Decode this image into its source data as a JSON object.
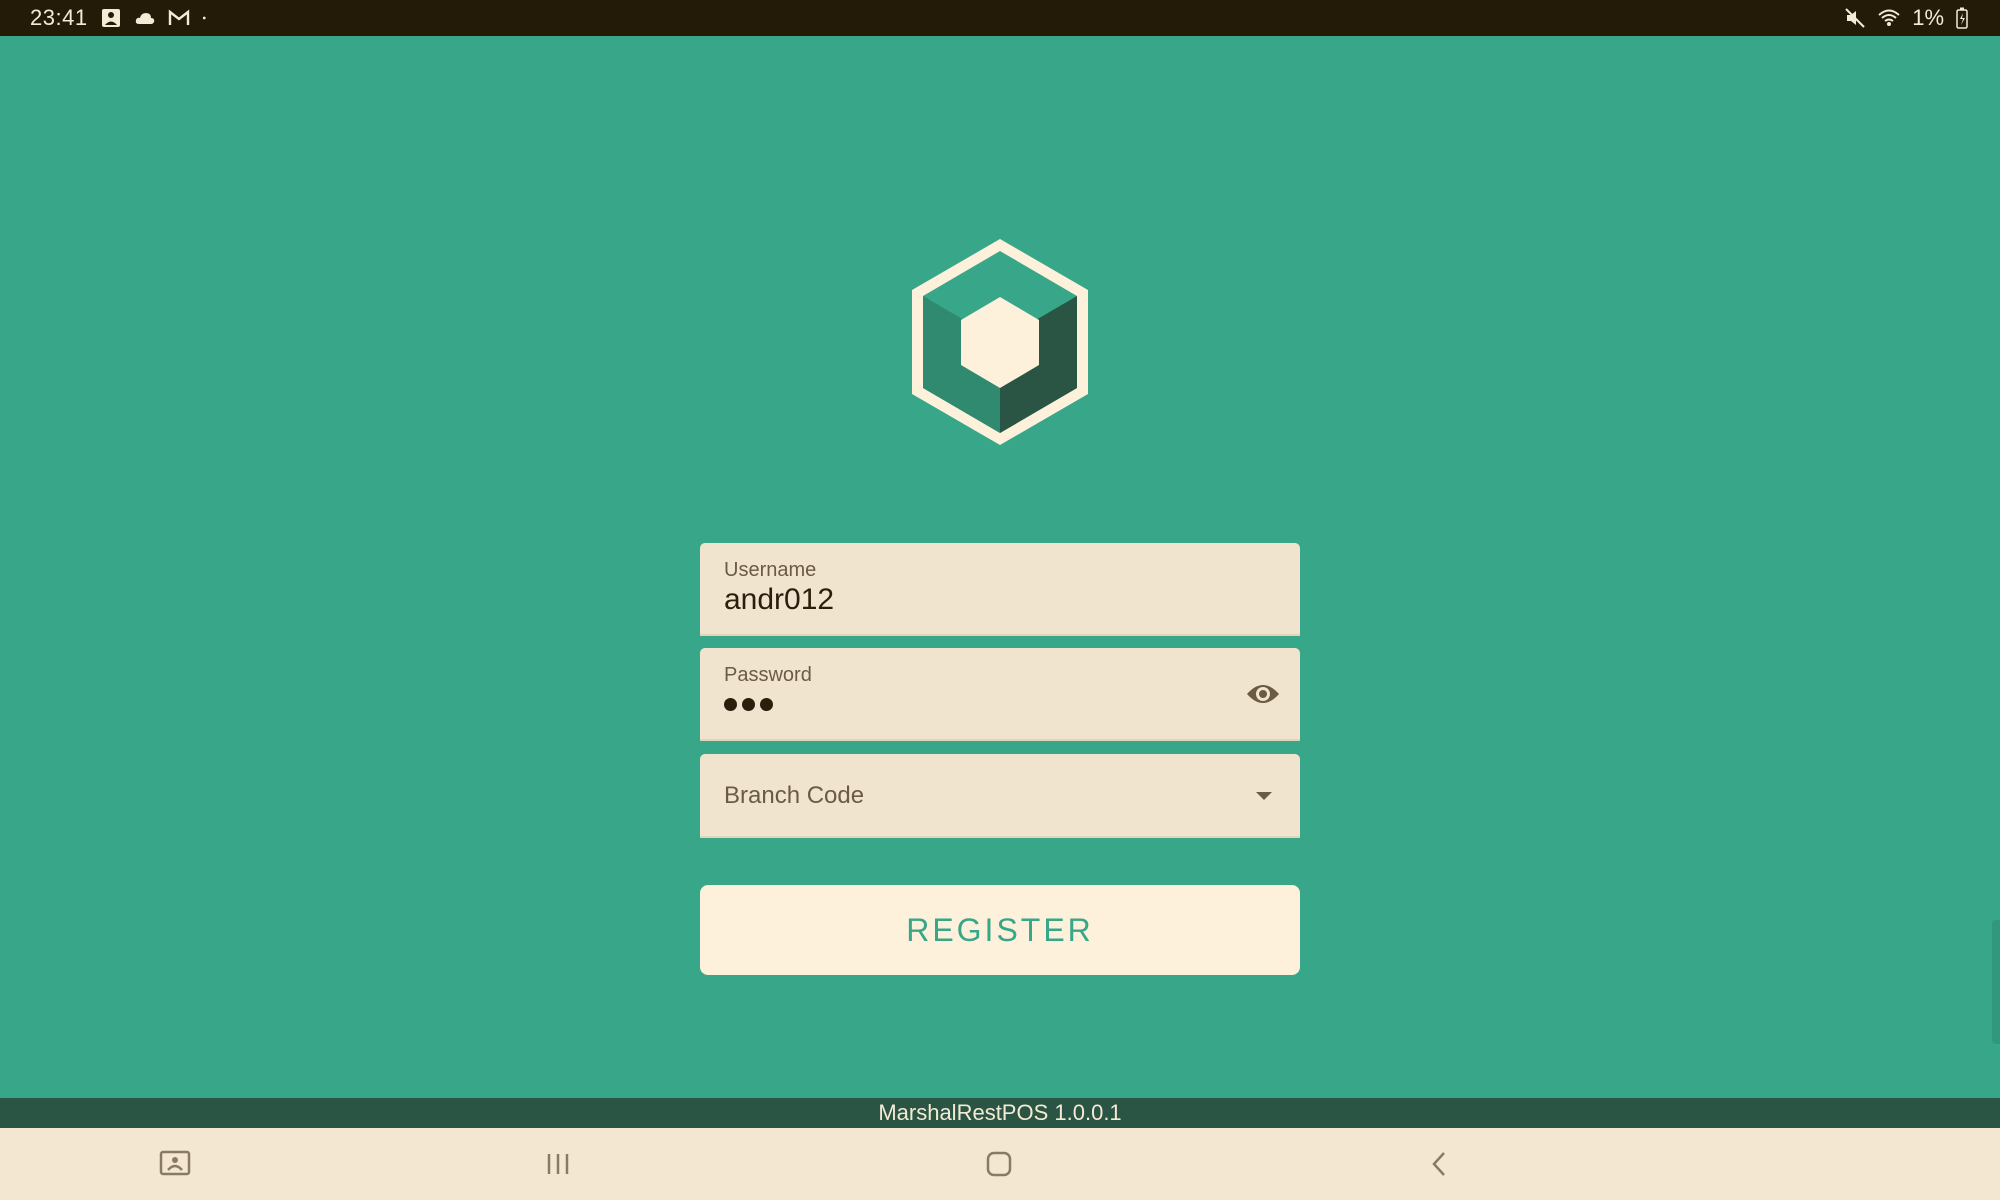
{
  "status_bar": {
    "time": "23:41",
    "left_icons": [
      "gallery-notification-icon",
      "cloud-icon",
      "gmail-icon",
      "dot-icon"
    ],
    "right_icons": [
      "mute-icon",
      "wifi-icon",
      "battery-icon"
    ],
    "battery": "1%"
  },
  "app": {
    "logo_icon": "hexagon-cube-logo",
    "version": "MarshalRestPOS 1.0.0.1"
  },
  "form": {
    "username": {
      "label": "Username",
      "value": "andr012"
    },
    "password": {
      "label": "Password",
      "masked_length": 3
    },
    "branch": {
      "placeholder": "Branch Code"
    },
    "register_label": "REGISTER"
  },
  "nav_bar": {
    "buttons": [
      "screen-capture-icon",
      "recent-apps-icon",
      "home-icon",
      "back-icon"
    ]
  },
  "colors": {
    "background": "#38a688",
    "field_bg": "#f1e4ce",
    "button_bg": "#fdf1dc",
    "button_text": "#38a688",
    "status_bar": "#231a08",
    "version_bar": "#2a5443",
    "nav_bar": "#f3e7d2"
  }
}
